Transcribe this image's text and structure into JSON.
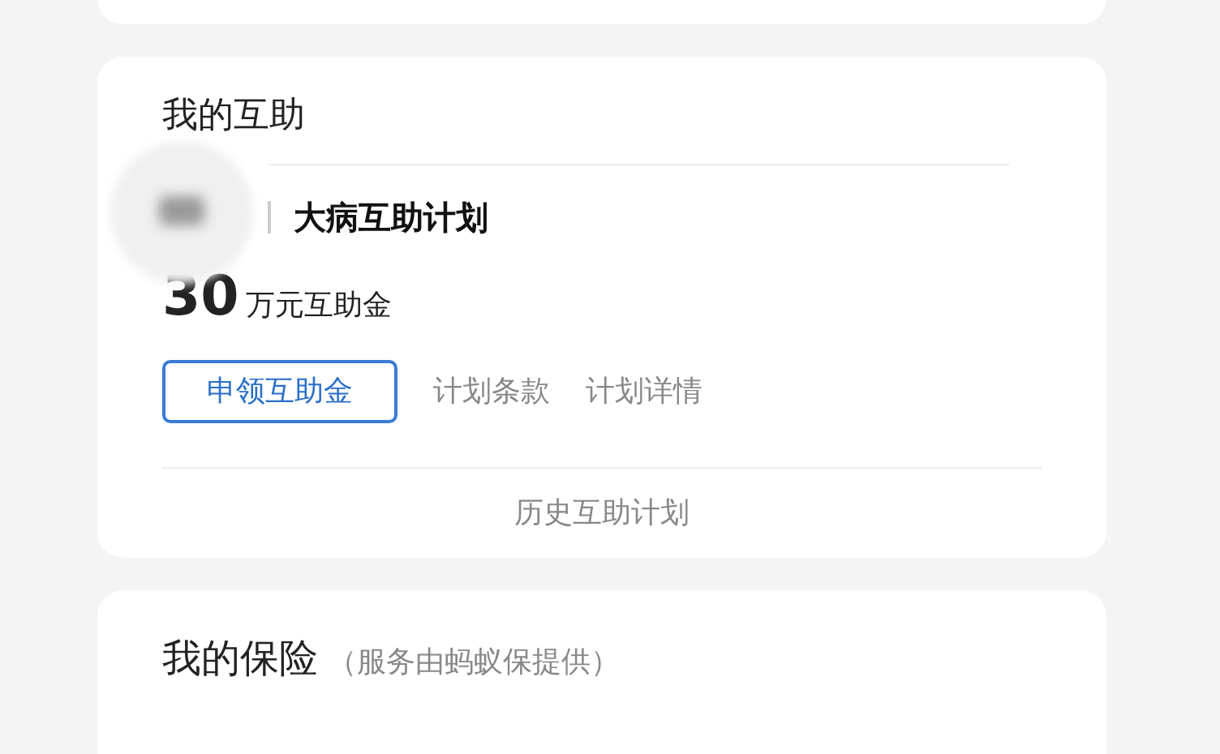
{
  "mutual_aid": {
    "title": "我的互助",
    "plan_name": "大病互助计划",
    "amount": "30",
    "amount_unit": "万元互助金",
    "actions": [
      {
        "label": "申领互助金",
        "kind": "primary"
      },
      {
        "label": "计划条款",
        "kind": "link"
      },
      {
        "label": "计划详情",
        "kind": "link"
      }
    ],
    "history_link": "历史互助计划"
  },
  "insurance": {
    "title": "我的保险",
    "subtitle": "（服务由蚂蚁保提供）"
  }
}
